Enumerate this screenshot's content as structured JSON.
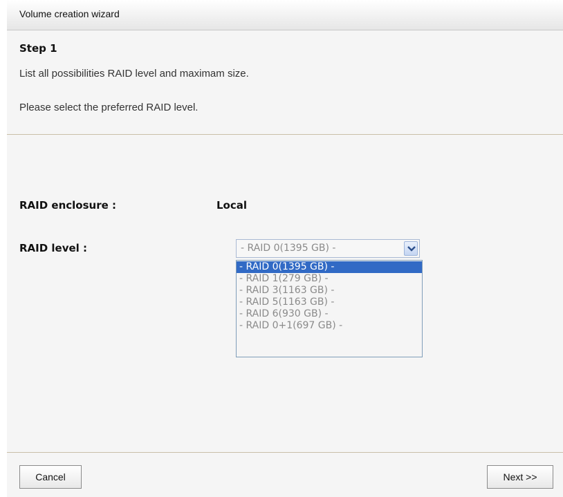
{
  "window": {
    "title": "Volume creation wizard"
  },
  "step": {
    "title": "Step 1",
    "description1": "List all possibilities RAID level and maximam size.",
    "description2": "Please select the preferred RAID level."
  },
  "form": {
    "enclosure_label": "RAID enclosure :",
    "enclosure_value": "Local",
    "level_label": "RAID level :",
    "level_selected": "- RAID 0(1395 GB) -",
    "level_options": [
      "- RAID 0(1395 GB) -",
      "- RAID 1(279 GB) -",
      "- RAID 3(1163 GB) -",
      "- RAID 5(1163 GB) -",
      "- RAID 6(930 GB) -",
      "- RAID 0+1(697 GB) -"
    ],
    "highlighted_option_index": 0
  },
  "buttons": {
    "cancel_label": "Cancel",
    "next_label": "Next >>"
  },
  "colors": {
    "highlight": "#316ac5",
    "divider": "#c9bfa8",
    "panel_bg": "#f5f5f5"
  },
  "icons": {
    "dropdown_arrow": "chevron-down-icon"
  }
}
